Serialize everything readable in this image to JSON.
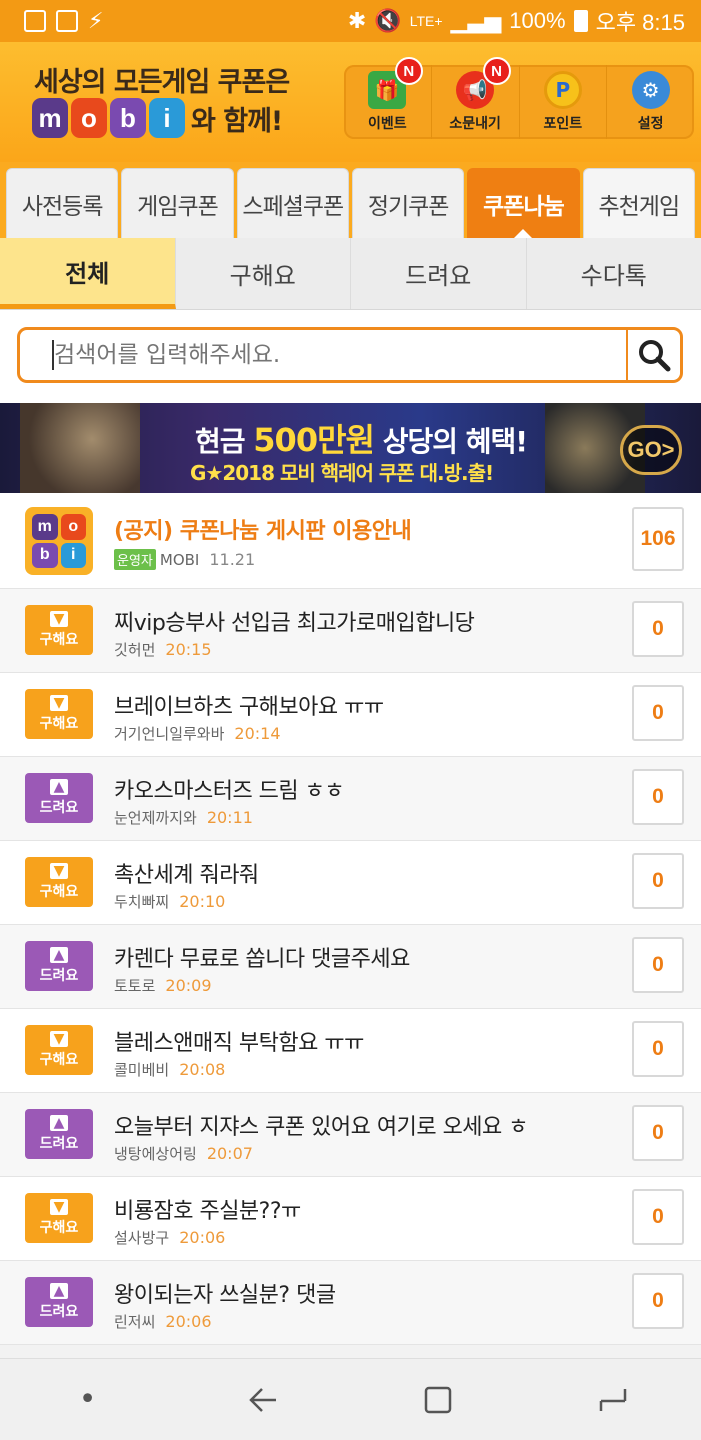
{
  "status_bar": {
    "battery": "100%",
    "time": "오후 8:15",
    "network": "LTE+"
  },
  "header": {
    "tagline": "세상의 모든게임 쿠폰은",
    "logo_letters": [
      "m",
      "o",
      "b",
      "i"
    ],
    "logo_suffix": "와 함께!",
    "menu": [
      {
        "label": "이벤트",
        "icon": "gift-icon",
        "new": "N"
      },
      {
        "label": "소문내기",
        "icon": "megaphone-icon",
        "new": "N"
      },
      {
        "label": "포인트",
        "icon": "point-coin-icon",
        "new": ""
      },
      {
        "label": "설정",
        "icon": "gear-icon",
        "new": ""
      }
    ]
  },
  "main_tabs": [
    "사전등록",
    "게임쿠폰",
    "스페셜쿠폰",
    "정기쿠폰",
    "쿠폰나눔",
    "추천게임"
  ],
  "active_main_tab": "쿠폰나눔",
  "sub_tabs": [
    "전체",
    "구해요",
    "드려요",
    "수다톡"
  ],
  "active_sub_tab": "전체",
  "search": {
    "placeholder": "검색어를 입력해주세요."
  },
  "banner": {
    "line1_pre": "현금 ",
    "line1_highlight": "500만원",
    "line1_post": " 상당의 혜택!",
    "line2": "G★2018  모비 핵레어 쿠폰 대.방.출!",
    "go": "GO>"
  },
  "notice": {
    "title": "(공지) 쿠폰나눔 게시판 이용안내",
    "badge": "운영자",
    "author": "MOBI",
    "date": "11.21",
    "count": "106"
  },
  "posts": [
    {
      "type": "구해요",
      "title": "찌vip승부사 선입금 최고가로매입합니당",
      "author": "깃허먼",
      "time": "20:15",
      "count": "0"
    },
    {
      "type": "구해요",
      "title": "브레이브하츠 구해보아요 ㅠㅠ",
      "author": "거기언니일루와바",
      "time": "20:14",
      "count": "0"
    },
    {
      "type": "드려요",
      "title": "카오스마스터즈 드림 ㅎㅎ",
      "author": "눈언제까지와",
      "time": "20:11",
      "count": "0"
    },
    {
      "type": "구해요",
      "title": "촉산세계 줘라줘",
      "author": "두치빠찌",
      "time": "20:10",
      "count": "0"
    },
    {
      "type": "드려요",
      "title": "카렌다 무료로 쏩니다 댓글주세요",
      "author": "토토로",
      "time": "20:09",
      "count": "0"
    },
    {
      "type": "구해요",
      "title": "블레스앤매직 부탁함요 ㅠㅠ",
      "author": "콜미베비",
      "time": "20:08",
      "count": "0"
    },
    {
      "type": "드려요",
      "title": "오늘부터 지쟈스 쿠폰 있어요 여기로 오세요 ㅎ",
      "author": "냉탕에상어링",
      "time": "20:07",
      "count": "0"
    },
    {
      "type": "구해요",
      "title": "비룡잠호 주실분??ㅠ",
      "author": "설사방구",
      "time": "20:06",
      "count": "0"
    },
    {
      "type": "드려요",
      "title": "왕이되는자 쓰실분? 댓글",
      "author": "린저씨",
      "time": "20:06",
      "count": "0"
    }
  ],
  "colors": {
    "brand_orange": "#f39a14",
    "buy": "#f7a21c",
    "give": "#9b59b6",
    "count_text": "#ee7d14"
  }
}
